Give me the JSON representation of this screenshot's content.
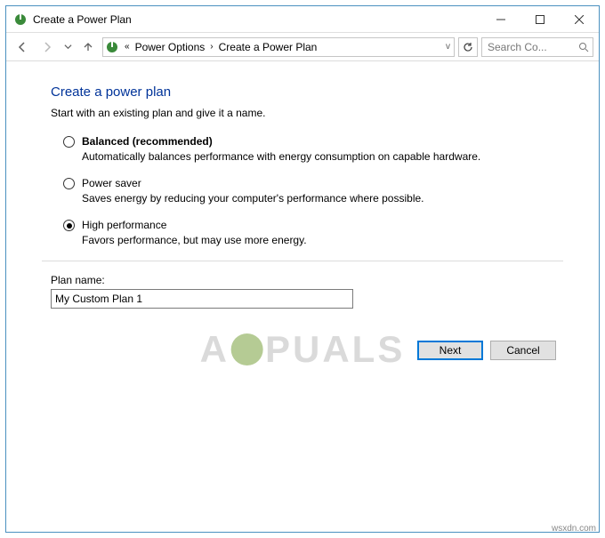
{
  "titlebar": {
    "title": "Create a Power Plan"
  },
  "breadcrumb": {
    "part1": "Power Options",
    "part2": "Create a Power Plan"
  },
  "search": {
    "placeholder": "Search Co..."
  },
  "main": {
    "heading": "Create a power plan",
    "subheading": "Start with an existing plan and give it a name.",
    "plans": [
      {
        "title": "Balanced (recommended)",
        "desc": "Automatically balances performance with energy consumption on capable hardware.",
        "selected": false,
        "bold": true
      },
      {
        "title": "Power saver",
        "desc": "Saves energy by reducing your computer's performance where possible.",
        "selected": false,
        "bold": false
      },
      {
        "title": "High performance",
        "desc": "Favors performance, but may use more energy.",
        "selected": true,
        "bold": false
      }
    ],
    "plan_name_label": "Plan name:",
    "plan_name_value": "My Custom Plan 1"
  },
  "buttons": {
    "next": "Next",
    "cancel": "Cancel"
  },
  "watermark": {
    "part1": "A",
    "part2": "PUALS"
  },
  "footer": "wsxdn.com"
}
